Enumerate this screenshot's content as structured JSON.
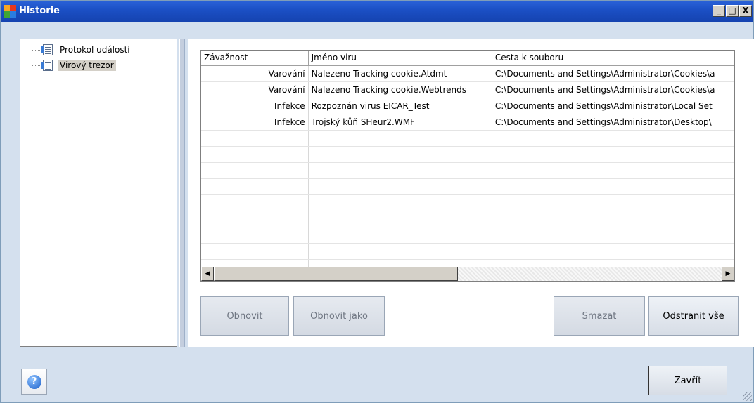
{
  "window": {
    "title": "Historie",
    "controls": {
      "minimize": "_",
      "maximize": "□",
      "close": "X"
    }
  },
  "tree": {
    "items": [
      {
        "label": "Protokol událostí",
        "icon": "log-document-icon",
        "selected": false
      },
      {
        "label": "Virový trezor",
        "icon": "vault-document-icon",
        "selected": true
      }
    ]
  },
  "table": {
    "columns": [
      "Závažnost",
      "Jméno viru",
      "Cesta k souboru"
    ],
    "rows": [
      [
        "Varování",
        "Nalezeno Tracking cookie.Atdmt",
        "C:\\Documents and Settings\\Administrator\\Cookies\\a"
      ],
      [
        "Varování",
        "Nalezeno Tracking cookie.Webtrends",
        "C:\\Documents and Settings\\Administrator\\Cookies\\a"
      ],
      [
        "Infekce",
        "Rozpoznán virus EICAR_Test",
        "C:\\Documents and Settings\\Administrator\\Local Set"
      ],
      [
        "Infekce",
        "Trojský kůň SHeur2.WMF",
        "C:\\Documents and Settings\\Administrator\\Desktop\\"
      ]
    ],
    "empty_rows": 9,
    "scroll_fraction": 0.48
  },
  "buttons": {
    "restore": "Obnovit",
    "restore_as": "Obnovit jako",
    "delete": "Smazat",
    "delete_all": "Odstranit vše",
    "close": "Zavřít",
    "help": "?"
  },
  "colors": {
    "titlebar": "#1b4fc4",
    "window_bg": "#d4e0ee",
    "selection": "#d4d0c8"
  }
}
